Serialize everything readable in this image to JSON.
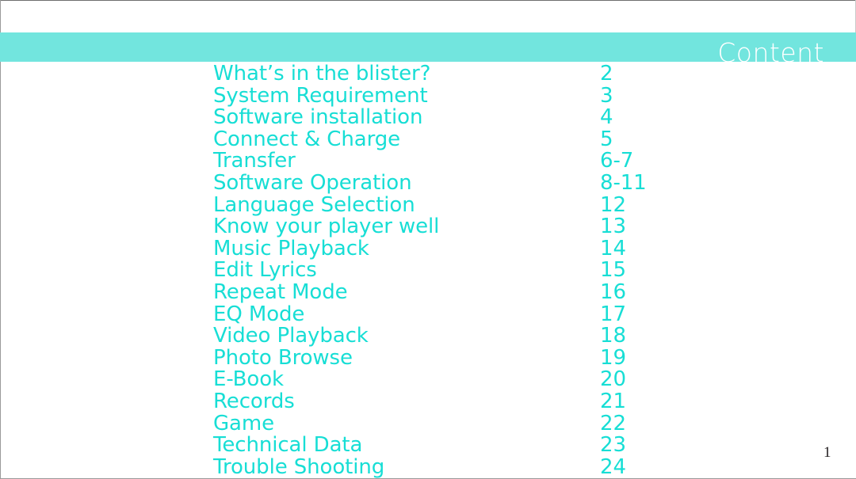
{
  "document": {
    "page_number": "1",
    "background_color": "#ffffff",
    "border_color": "#9a9a9a"
  },
  "header": {
    "title": "Content",
    "band_color": "#72e5de",
    "title_color": "#ffffff"
  },
  "toc": {
    "text_color": "#17ded5",
    "entries": [
      {
        "title": "What’s in the blister?",
        "page": "2"
      },
      {
        "title": "System Requirement",
        "page": "3"
      },
      {
        "title": "Software installation",
        "page": "4"
      },
      {
        "title": "Connect & Charge",
        "page": "5"
      },
      {
        "title": "Transfer",
        "page": "6-7"
      },
      {
        "title": "Software Operation",
        "page": "8-11"
      },
      {
        "title": "Language Selection",
        "page": "12"
      },
      {
        "title": "Know your player well",
        "page": "13"
      },
      {
        "title": "Music Playback",
        "page": "14"
      },
      {
        "title": "Edit Lyrics",
        "page": "15"
      },
      {
        "title": "Repeat Mode",
        "page": "16"
      },
      {
        "title": "EQ Mode",
        "page": "17"
      },
      {
        "title": "Video Playback",
        "page": "18"
      },
      {
        "title": "Photo Browse",
        "page": "19"
      },
      {
        "title": "E-Book",
        "page": "20"
      },
      {
        "title": "Records",
        "page": "21"
      },
      {
        "title": "Game",
        "page": "22"
      },
      {
        "title": "Technical Data",
        "page": "23"
      },
      {
        "title": "Trouble Shooting",
        "page": "24"
      }
    ]
  }
}
